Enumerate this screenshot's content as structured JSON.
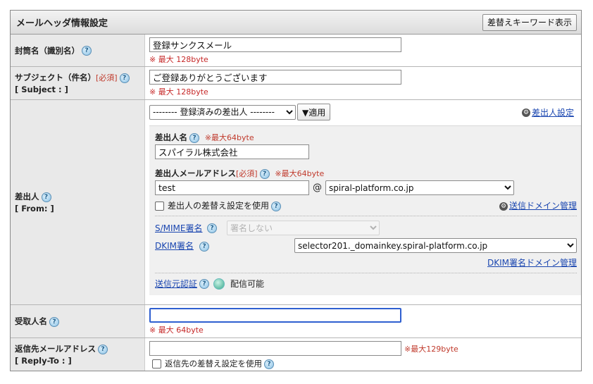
{
  "header": {
    "title": "メールヘッダ情報設定",
    "keyword_button": "差替えキーワード表示"
  },
  "envelope_name": {
    "label": "封筒名（識別名）",
    "value": "登録サンクスメール",
    "note": "※ 最大 128byte"
  },
  "subject": {
    "label": "サブジェクト（件名）",
    "required": "[必須]",
    "sublabel": "[ Subject : ]",
    "value": "ご登録ありがとうございます",
    "note": "※ 最大 128byte"
  },
  "sender": {
    "label": "差出人",
    "sublabel": "[ From: ]",
    "registered_select": "-------- 登録済みの差出人 --------",
    "apply_button": "▼適用",
    "sender_settings_link": "差出人設定",
    "name_label": "差出人名",
    "name_note": "※最大64byte",
    "name_value": "スパイラル株式会社",
    "address_label": "差出人メールアドレス",
    "address_required": "[必須]",
    "address_note": "※最大64byte",
    "address_local": "test",
    "at_sign": "@",
    "address_domain": "spiral-platform.co.jp",
    "replace_checkbox_label": "差出人の差替え設定を使用",
    "domain_mgmt_link": "送信ドメイン管理",
    "smime_label": "S/MIME署名",
    "smime_select": "署名しない",
    "dkim_label": "DKIM署名",
    "dkim_select": "selector201._domainkey.spiral-platform.co.jp",
    "dkim_domain_link": "DKIM署名ドメイン管理",
    "auth_label": "送信元認証",
    "auth_status": "配信可能"
  },
  "recipient": {
    "label": "受取人名",
    "value": "",
    "note": "※ 最大 64byte"
  },
  "reply_to": {
    "label": "返信先メールアドレス",
    "sublabel": "[ Reply-To : ]",
    "value": "",
    "note": "※最大129byte",
    "replace_checkbox_label": "返信先の差替え設定を使用"
  }
}
